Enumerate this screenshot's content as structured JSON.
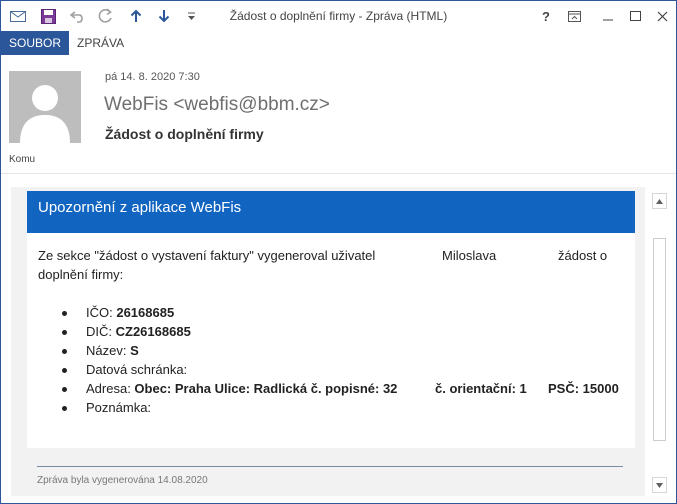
{
  "window": {
    "title": "Žádost o doplnění firmy - Zpráva (HTML)",
    "help_label": "?",
    "accent_color": "#2b579a"
  },
  "quick_access": {
    "icons": [
      "mail-icon",
      "save-icon",
      "undo-icon",
      "redo-icon",
      "up-arrow-icon",
      "down-arrow-icon",
      "more-icon"
    ]
  },
  "ribbon": {
    "tabs": [
      {
        "label": "SOUBOR",
        "active": true
      },
      {
        "label": "ZPRÁVA",
        "active": false
      }
    ]
  },
  "header": {
    "date": "pá 14. 8. 2020 7:30",
    "sender": "WebFis <webfis@bbm.cz>",
    "subject": "Žádost o doplnění firmy",
    "to_label": "Komu"
  },
  "message": {
    "banner_title": "Upozornění z aplikace WebFis",
    "banner_color": "#1165c1",
    "intro_part1": "Ze sekce \"žádost o vystavení faktury\" vygeneroval uživatel",
    "intro_user": "Miloslava",
    "intro_part2": "žádost o",
    "intro_line2": "doplnění firmy:",
    "items": [
      {
        "label": "IČO: ",
        "value": "26168685"
      },
      {
        "label": "DIČ: ",
        "value": "CZ26168685"
      },
      {
        "label": "Název: ",
        "value": "S"
      },
      {
        "label": "Datová schránka:",
        "value": ""
      },
      {
        "label": "Adresa: ",
        "value": "Obec: Praha Ulice: Radlická č. popisné: 32",
        "value2": "č. orientační: 1",
        "value3": "PSČ: 15000"
      },
      {
        "label": "Poznámka:",
        "value": ""
      }
    ],
    "footer": "Zpráva byla vygenerována 14.08.2020"
  }
}
